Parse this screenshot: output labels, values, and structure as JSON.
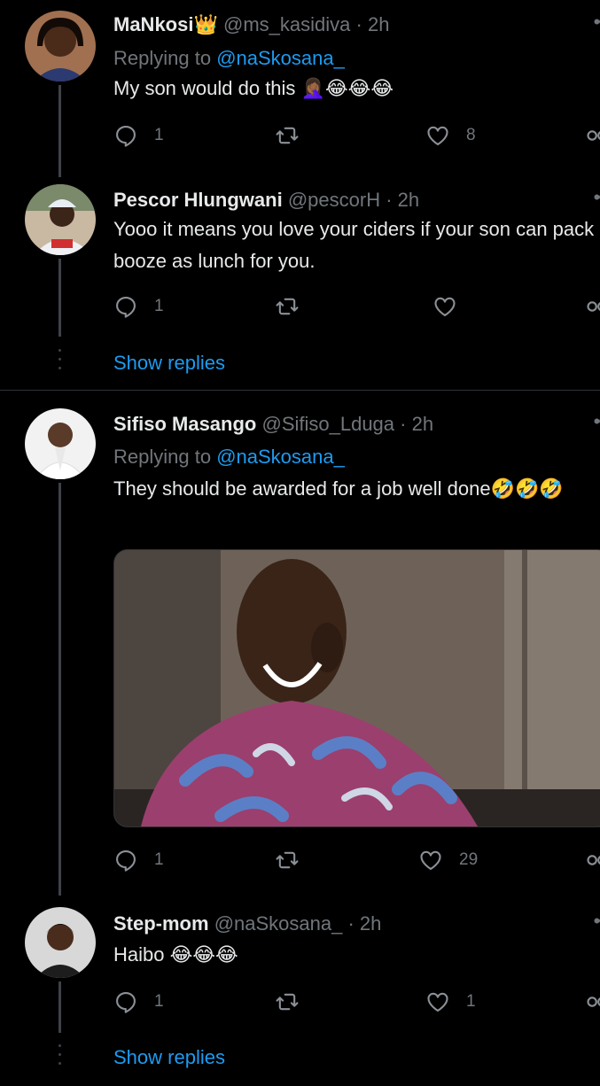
{
  "tweets": [
    {
      "name": "MaNkosi👑",
      "handle": "@ms_kasidiva",
      "time": "· 2h",
      "replying_prefix": "Replying to ",
      "replying_to": "@naSkosana_",
      "text": "My son would do this 🤦🏾‍♀️😂😂😂",
      "replies": "1",
      "retweets": "",
      "likes": "8"
    },
    {
      "name": "Pescor Hlungwani",
      "handle": "@pescorH",
      "time": "· 2h",
      "text": "Yooo it means you love your ciders if your son can pack booze as lunch for you.",
      "replies": "1",
      "retweets": "",
      "likes": ""
    },
    {
      "name": "Sifiso Masango",
      "handle": "@Sifiso_Lduga",
      "time": "· 2h",
      "replying_prefix": "Replying to ",
      "replying_to": "@naSkosana_",
      "text": "They should be awarded for a job well done🤣🤣🤣",
      "replies": "1",
      "retweets": "",
      "likes": "29"
    },
    {
      "name": "Step-mom",
      "handle": "@naSkosana_",
      "time": "· 2h",
      "text": "Haibo 😂😂😂",
      "replies": "1",
      "retweets": "",
      "likes": "1"
    }
  ],
  "show_replies": "Show replies",
  "colors": {
    "background": "#000000",
    "accent": "#1d9bf0",
    "muted": "#71767b",
    "text": "#e7e9ea"
  },
  "icons": [
    "reply-icon",
    "retweet-icon",
    "like-icon",
    "share-icon",
    "more-icon"
  ]
}
